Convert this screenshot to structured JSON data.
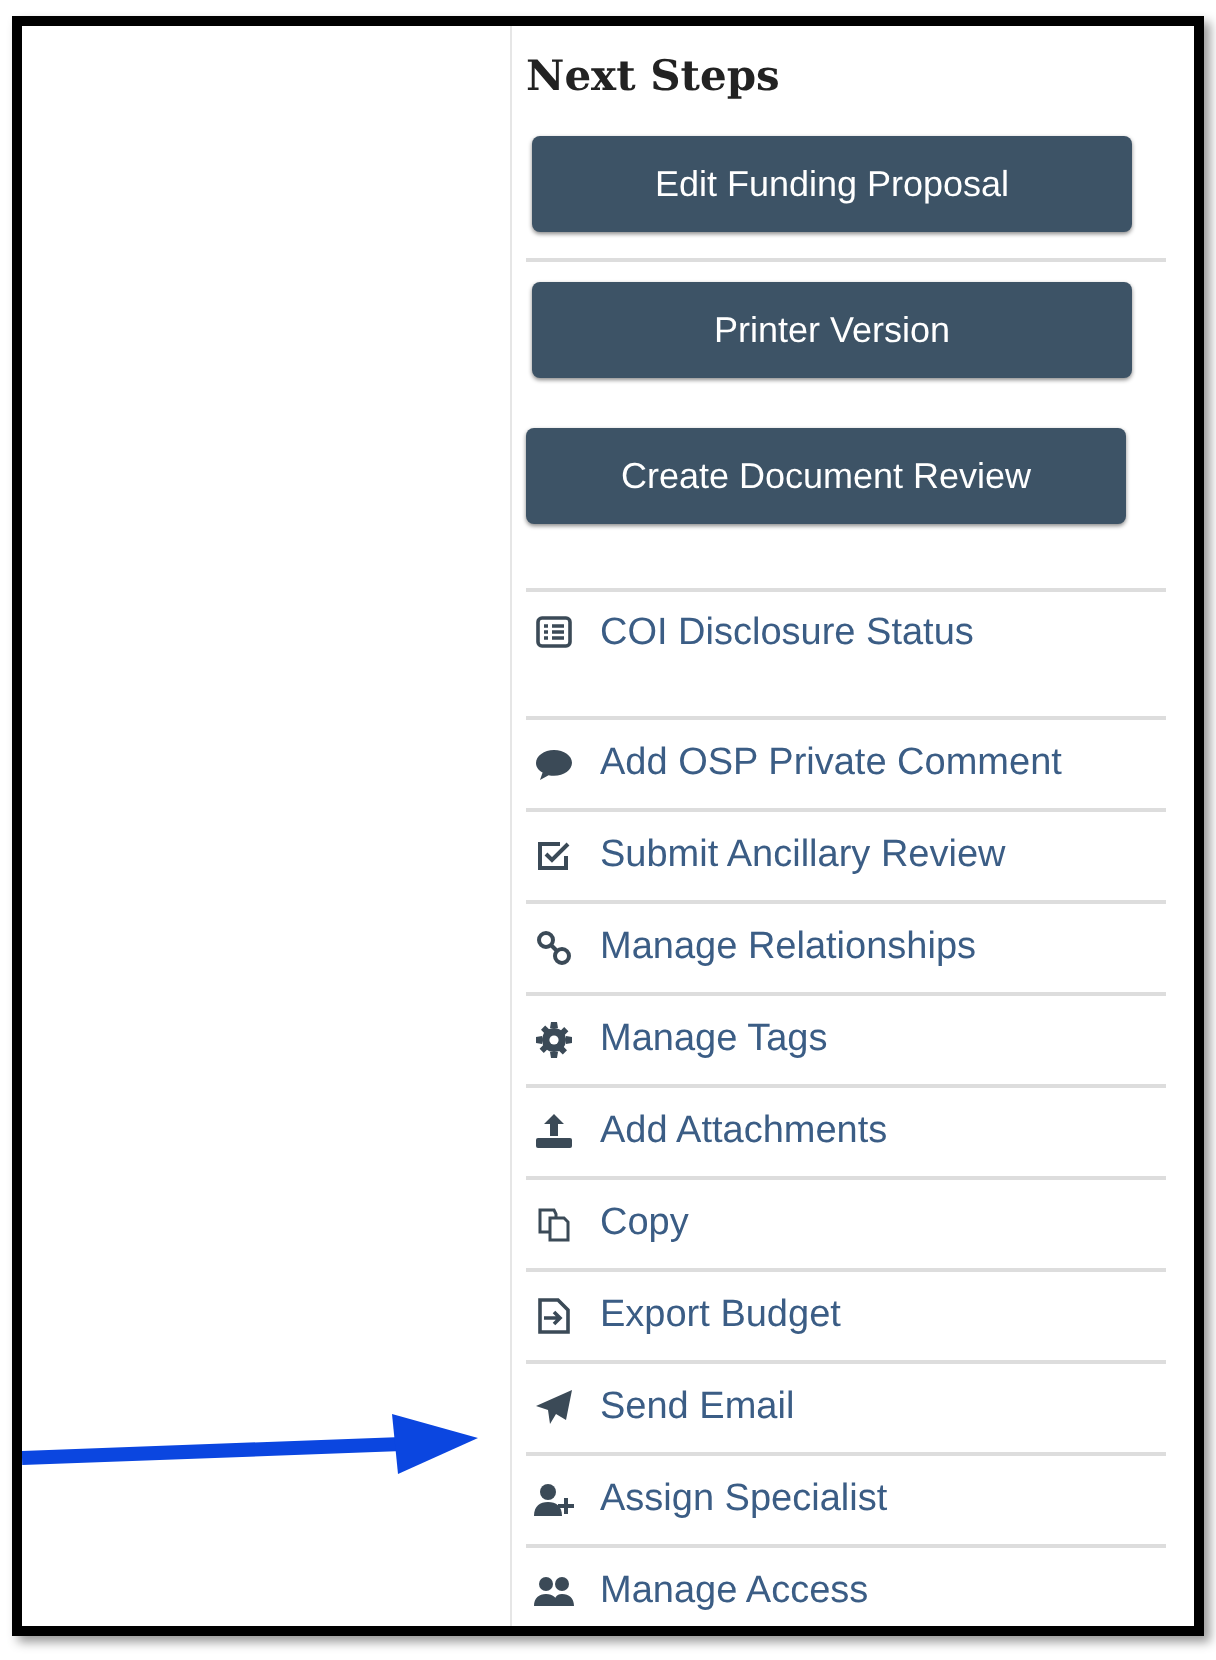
{
  "panel": {
    "title": "Next Steps",
    "buttons": [
      "Edit Funding Proposal",
      "Printer Version",
      "Create Document Review"
    ],
    "actions": [
      {
        "label": "COI Disclosure Status"
      },
      {
        "label": "Add OSP Private Comment"
      },
      {
        "label": "Submit Ancillary Review"
      },
      {
        "label": "Manage Relationships"
      },
      {
        "label": "Manage Tags"
      },
      {
        "label": "Add Attachments"
      },
      {
        "label": "Copy"
      },
      {
        "label": "Export Budget"
      },
      {
        "label": "Send Email"
      },
      {
        "label": "Assign Specialist"
      },
      {
        "label": "Manage Access"
      }
    ]
  }
}
